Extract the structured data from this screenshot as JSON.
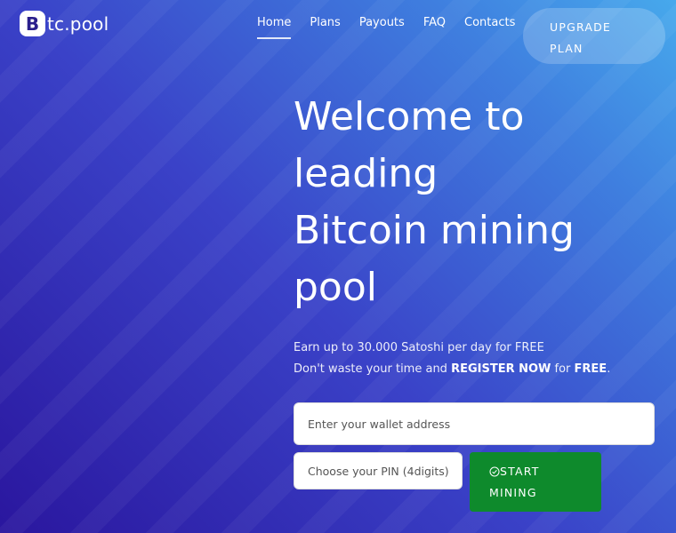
{
  "brand": {
    "logo_letter": "B",
    "name": "tc.pool"
  },
  "nav": {
    "items": [
      {
        "label": "Home",
        "active": true
      },
      {
        "label": "Plans",
        "active": false
      },
      {
        "label": "Payouts",
        "active": false
      },
      {
        "label": "FAQ",
        "active": false
      },
      {
        "label": "Contacts",
        "active": false
      }
    ],
    "upgrade": {
      "line1": "UPGRADE",
      "line2": "PLAN"
    }
  },
  "hero": {
    "headline_lines": [
      "Welcome to",
      "leading",
      "Bitcoin mining",
      "pool"
    ],
    "sub1": "Earn up to 30.000 Satoshi per day for FREE",
    "sub2_pre": "Don't waste your time and ",
    "sub2_register": "REGISTER NOW",
    "sub2_mid": " for ",
    "sub2_free": "FREE",
    "sub2_end": "."
  },
  "form": {
    "wallet_placeholder": "Enter your wallet address",
    "pin_placeholder": "Choose your PIN (4digits)",
    "start_line1": "START",
    "start_line2": "MINING",
    "start_icon": "check-circle-icon"
  },
  "colors": {
    "bg_start": "#2a169e",
    "bg_end": "#47a9ec",
    "start_button": "#0e8a2c"
  }
}
